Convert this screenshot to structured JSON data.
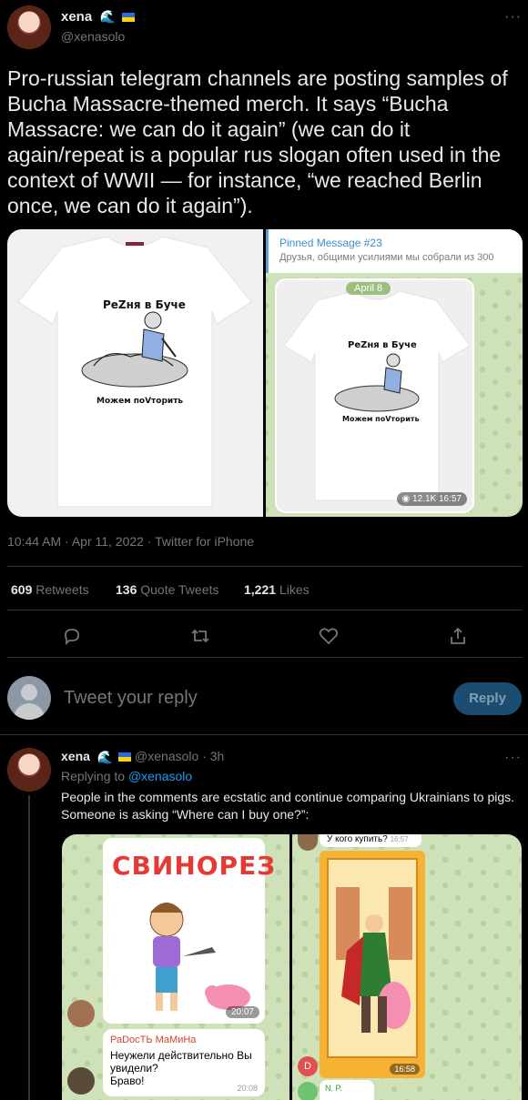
{
  "tweet": {
    "author_name": "xena",
    "author_handle": "@xenasolo",
    "text": "Pro-russian telegram channels are posting samples of Bucha Massacre-themed merch. It says “Bucha Massacre: we can do it again” (we can do it again/repeat is a popular rus slogan often used in the context of WWII — for instance, “we reached Berlin once, we can do it again”).",
    "meta": "10:44 AM · Apr 11, 2022 · Twitter for iPhone",
    "media_left": {
      "shirt_line1": "РеZня в Буче",
      "shirt_line2": "Можем поVторить"
    },
    "media_right": {
      "pinned_title": "Pinned Message #23",
      "pinned_text": "Друзья, общими усилиями мы собрали из 300",
      "date_badge": "April 8",
      "shirt_line1": "РеZня в Буче",
      "shirt_line2": "Можем поVторить",
      "views": "12.1K",
      "time": "16:57"
    },
    "stats": {
      "retweets_count": "609",
      "retweets_label": "Retweets",
      "quotes_count": "136",
      "quotes_label": "Quote Tweets",
      "likes_count": "1,221",
      "likes_label": "Likes"
    },
    "actions": [
      "reply-icon",
      "retweet-icon",
      "like-icon",
      "share-icon"
    ]
  },
  "composer": {
    "placeholder": "Tweet your reply",
    "button": "Reply"
  },
  "reply": {
    "author_name": "xena",
    "author_handle": "@xenasolo",
    "time": "· 3h",
    "replying_prefix": "Replying to",
    "replying_to": "@xenasolo",
    "text": "People in the comments are ecstatic and continue comparing Ukrainians to pigs. Someone is asking “Where can I buy one?”:",
    "media_left": {
      "title": "СВИНОРЕЗ",
      "sticker_time": "20:07",
      "commenter": "РаDосТЬ МаМиНа",
      "comment": "Неужели действительно Вы увидели?\nБраво!",
      "comment_time": "20:08"
    },
    "media_right": {
      "question": "У кого купить?",
      "question_time": "16:57",
      "poster_time": "16:58",
      "initial_d": "D",
      "np": "N. P."
    }
  },
  "colors": {
    "background": "#000000",
    "accent": "#1d9bf0",
    "muted": "#71767b",
    "telegram_green": "#cfe1b8"
  }
}
